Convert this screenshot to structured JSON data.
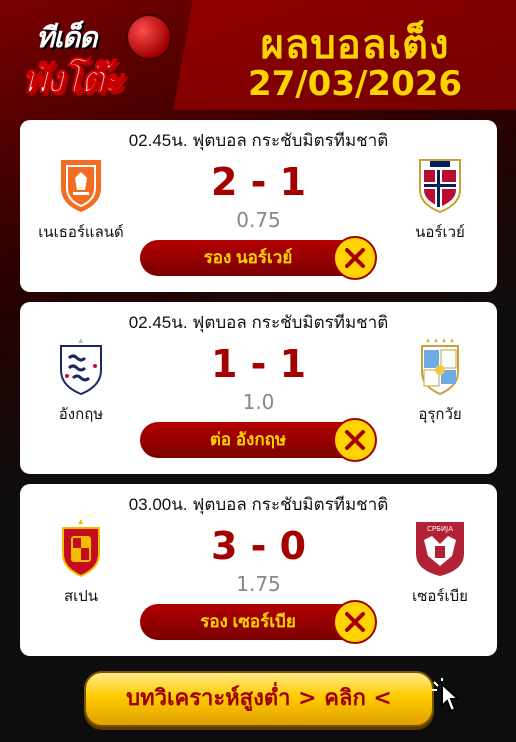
{
  "header": {
    "logo_line1": "ทีเด็ด",
    "logo_line2": "พังโต๊ะ",
    "title": "ผลบอลเต็ง",
    "date": "27/03/2026"
  },
  "matches": [
    {
      "league": "02.45น. ฟุตบอล กระชับมิตรทีมชาติ",
      "home": "เนเธอร์แลนด์",
      "away": "นอร์เวย์",
      "score": "2 - 1",
      "handicap": "0.75",
      "pick": "รอง นอร์เวย์",
      "result_icon": "x-icon",
      "home_crest": "netherlands-crest-icon",
      "away_crest": "norway-crest-icon"
    },
    {
      "league": "02.45น. ฟุตบอล กระชับมิตรทีมชาติ",
      "home": "อังกฤษ",
      "away": "อุรุกวัย",
      "score": "1 - 1",
      "handicap": "1.0",
      "pick": "ต่อ อังกฤษ",
      "result_icon": "x-icon",
      "home_crest": "england-crest-icon",
      "away_crest": "uruguay-crest-icon"
    },
    {
      "league": "03.00น. ฟุตบอล กระชับมิตรทีมชาติ",
      "home": "สเปน",
      "away": "เซอร์เบีย",
      "score": "3 - 0",
      "handicap": "1.75",
      "pick": "รอง เซอร์เบีย",
      "result_icon": "x-icon",
      "home_crest": "spain-crest-icon",
      "away_crest": "serbia-crest-icon",
      "away_crest_text": "СРБИЈА"
    }
  ],
  "cta": {
    "label": "บทวิเคราะห์สูงต่ำ > คลิก <"
  },
  "colors": {
    "accent": "#a50000",
    "gold": "#ffd400",
    "card": "#ffffff"
  }
}
